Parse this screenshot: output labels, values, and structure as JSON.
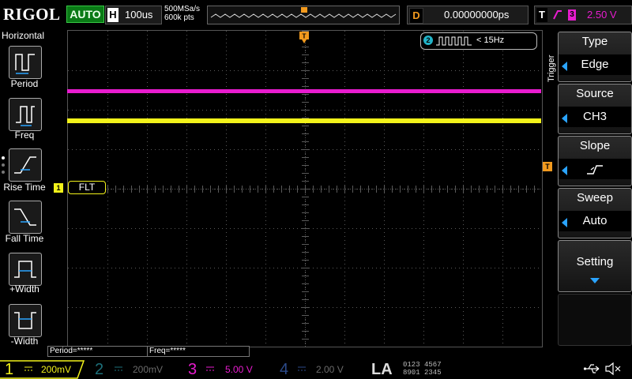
{
  "top": {
    "brand": "RIGOL",
    "run_state": "AUTO",
    "timebase_label": "H",
    "timebase_value": "100us",
    "sample_rate": "500MSa/s",
    "mem_depth": "600k pts",
    "delay_label": "D",
    "delay_value": "0.00000000ps",
    "trigger_label": "T",
    "trigger_source_num": "3",
    "trigger_level": "2.50 V"
  },
  "left_menu": {
    "title": "Horizontal",
    "items": [
      {
        "label": "Period"
      },
      {
        "label": "Freq"
      },
      {
        "label": "Rise Time"
      },
      {
        "label": "Fall Time"
      },
      {
        "label": "+Width"
      },
      {
        "label": "-Width"
      }
    ]
  },
  "screen": {
    "ch1_marker": "1",
    "filter_label": "FLT",
    "trigger_marker": "T",
    "freq_channel": "2",
    "freq_value": "< 15Hz",
    "meas_period": "Period=*****",
    "meas_freq": "Freq=*****"
  },
  "right_menu": {
    "title": "Trigger",
    "type_head": "Type",
    "type_value": "Edge",
    "source_head": "Source",
    "source_value": "CH3",
    "slope_head": "Slope",
    "sweep_head": "Sweep",
    "sweep_value": "Auto",
    "setting_head": "Setting"
  },
  "bottom": {
    "ch1_num": "1",
    "ch1_scale": "200mV",
    "ch2_num": "2",
    "ch2_scale": "200mV",
    "ch3_num": "3",
    "ch3_scale": "5.00 V",
    "ch4_num": "4",
    "ch4_scale": "2.00 V",
    "la_label": "LA",
    "la_row1": "0123 4567",
    "la_row2": "8901 2345"
  },
  "colors": {
    "ch1": "#f2f21a",
    "ch2": "#22b3c8",
    "ch3": "#e81ccf",
    "ch4": "#2b6cf2",
    "trigger": "#f29a1e",
    "menu_arrow": "#2aa4ff",
    "run": "#0a7a16"
  },
  "icons": {
    "usb": "usb-icon",
    "mute": "speaker-mute-icon"
  }
}
